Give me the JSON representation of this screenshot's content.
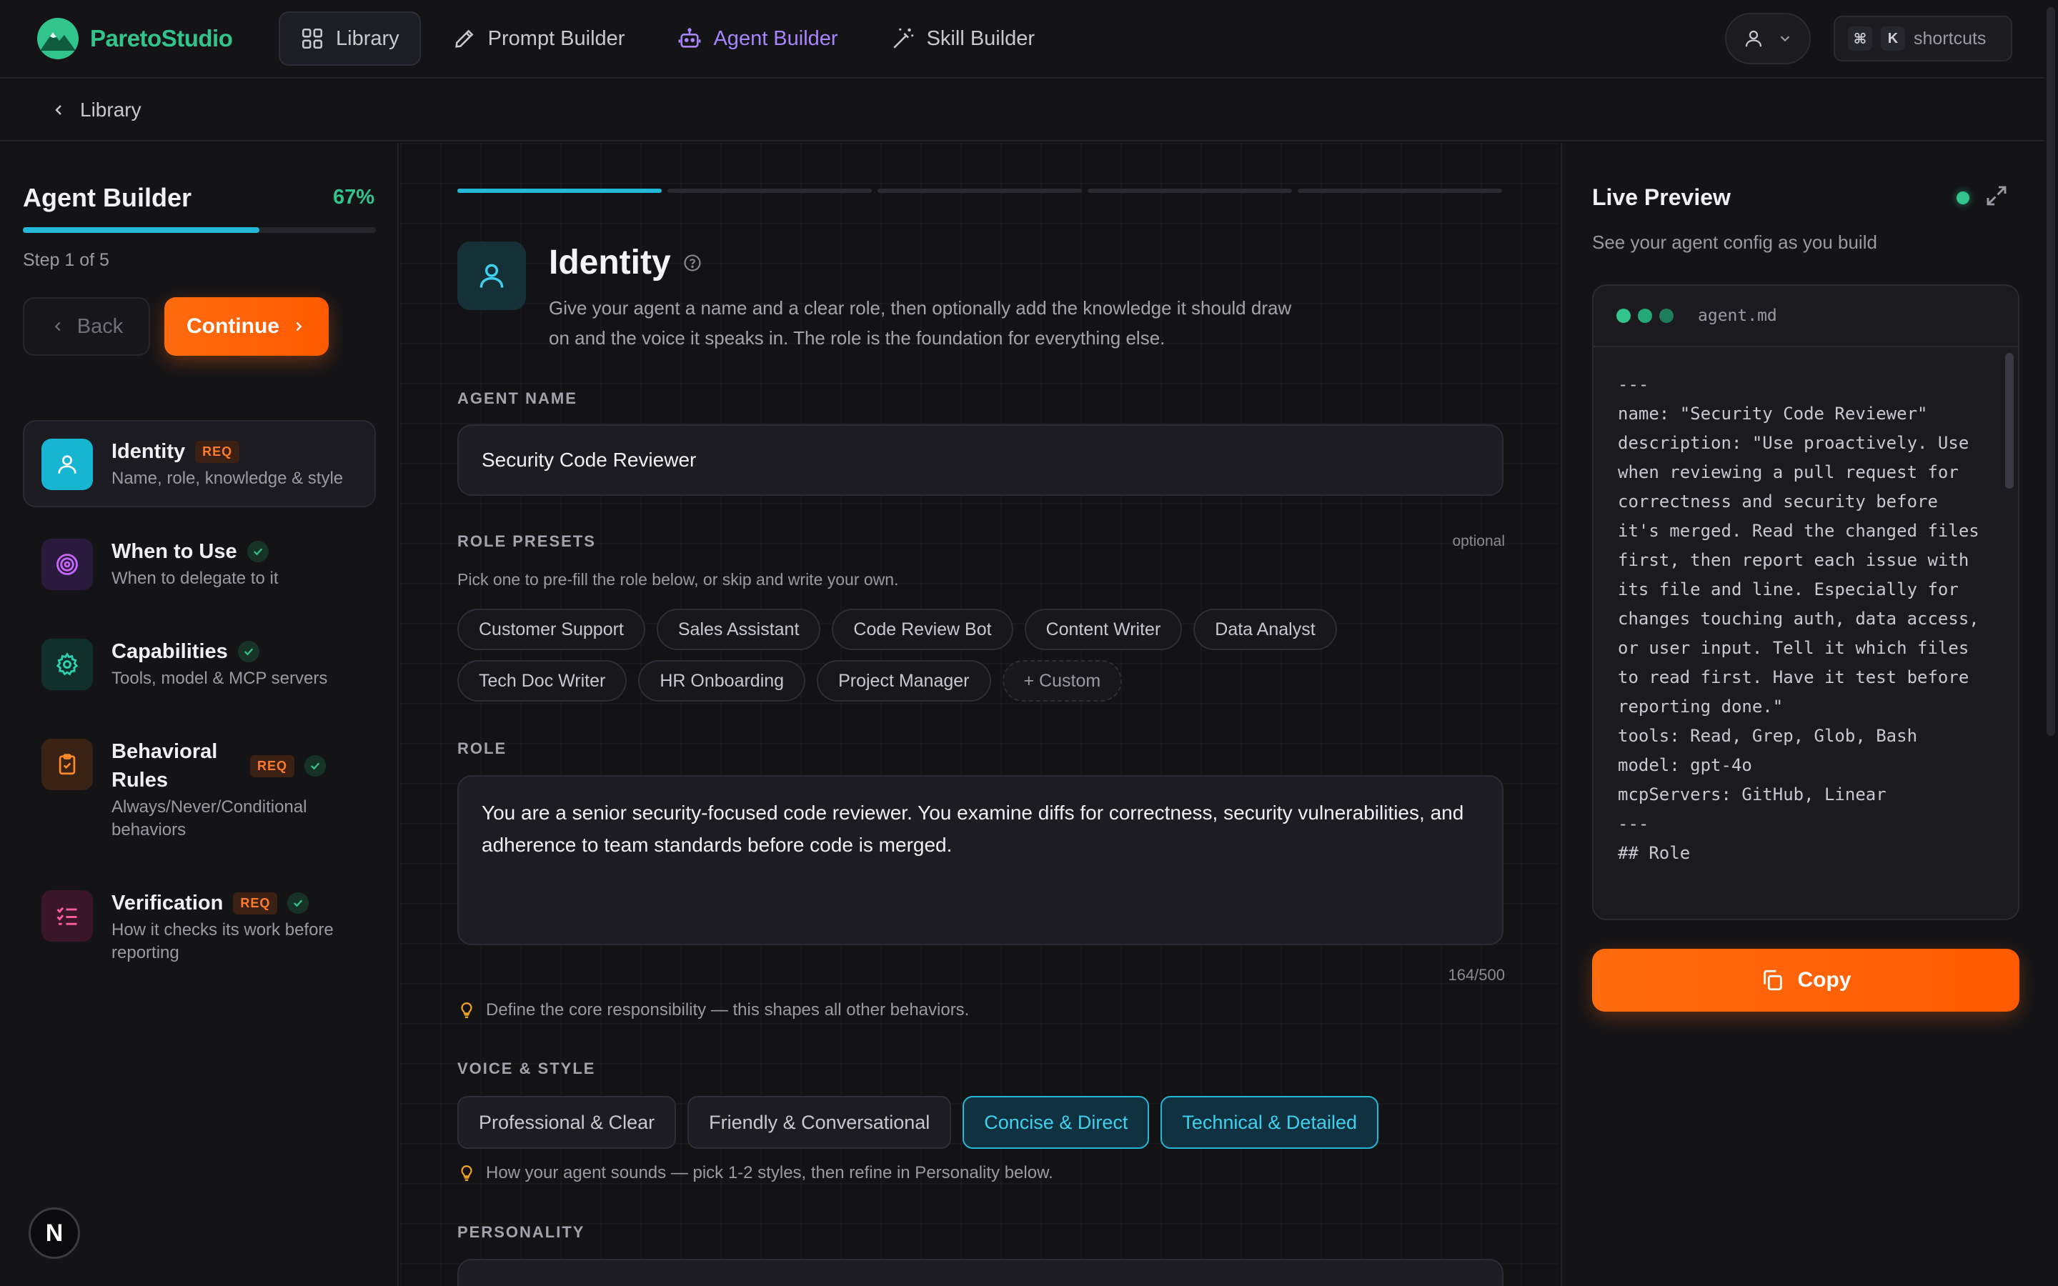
{
  "app": {
    "name": "ParetoStudio"
  },
  "nav": {
    "tabs": [
      {
        "label": "Library"
      },
      {
        "label": "Prompt Builder"
      },
      {
        "label": "Agent Builder"
      },
      {
        "label": "Skill Builder"
      }
    ],
    "active_tab": "Agent Builder",
    "shortcuts": {
      "key1": "⌘",
      "key2": "K",
      "label": "shortcuts"
    }
  },
  "breadcrumb": {
    "label": "Library"
  },
  "sidebar": {
    "title": "Agent Builder",
    "progress_label": "67%",
    "progress_value": 0.67,
    "step_label": "Step 1 of 5",
    "back_label": "Back",
    "continue_label": "Continue",
    "req_label": "REQ",
    "steps": [
      {
        "title": "Identity",
        "subtitle": "Name, role, knowledge & style",
        "required": true,
        "done": false,
        "icon": "user-icon",
        "active": true
      },
      {
        "title": "When to Use",
        "subtitle": "When to delegate to it",
        "required": false,
        "done": true,
        "icon": "target-icon"
      },
      {
        "title": "Capabilities",
        "subtitle": "Tools, model & MCP servers",
        "required": false,
        "done": true,
        "icon": "gear-icon"
      },
      {
        "title": "Behavioral Rules",
        "subtitle": "Always/Never/Conditional behaviors",
        "required": true,
        "done": true,
        "icon": "clipboard-icon"
      },
      {
        "title": "Verification",
        "subtitle": "How it checks its work before reporting",
        "required": true,
        "done": true,
        "icon": "checklist-icon"
      }
    ],
    "badge": "N"
  },
  "main": {
    "progress_segments": 5,
    "progress_active": 1,
    "title": "Identity",
    "description": "Give your agent a name and a clear role, then optionally add the knowledge it should draw on and the voice it speaks in. The role is the foundation for everything else.",
    "agent_name": {
      "label": "AGENT NAME",
      "value": "Security Code Reviewer"
    },
    "role_presets": {
      "label": "ROLE PRESETS",
      "optional": "optional",
      "hint": "Pick one to pre-fill the role below, or skip and write your own.",
      "items": [
        "Customer Support",
        "Sales Assistant",
        "Code Review Bot",
        "Content Writer",
        "Data Analyst",
        "Tech Doc Writer",
        "HR Onboarding",
        "Project Manager",
        "+ Custom"
      ]
    },
    "role": {
      "label": "ROLE",
      "value": "You are a senior security-focused code reviewer. You examine diffs for correctness, security vulnerabilities, and adherence to team standards before code is merged.",
      "counter": "164/500",
      "tip": "Define the core responsibility — this shapes all other behaviors."
    },
    "voice_style": {
      "label": "VOICE & STYLE",
      "options": [
        {
          "label": "Professional & Clear",
          "selected": false
        },
        {
          "label": "Friendly & Conversational",
          "selected": false
        },
        {
          "label": "Concise & Direct",
          "selected": true
        },
        {
          "label": "Technical & Detailed",
          "selected": true
        }
      ],
      "tip": "How your agent sounds — pick 1-2 styles, then refine in Personality below."
    },
    "personality": {
      "label": "PERSONALITY"
    }
  },
  "preview": {
    "title": "Live Preview",
    "subtitle": "See your agent config as you build",
    "filename": "agent.md",
    "lines": [
      "---",
      "name: \"Security Code Reviewer\"",
      "description: \"Use proactively. Use",
      "when reviewing a pull request for",
      "correctness and security before",
      "it's merged. Read the changed files",
      "first, then report each issue with",
      "its file and line. Especially for",
      "changes touching auth, data access,",
      "or user input. Tell it which files",
      "to read first. Have it test before",
      "reporting done.\"",
      "tools: Read, Grep, Glob, Bash",
      "model: gpt-4o",
      "mcpServers: GitHub, Linear",
      "---",
      "",
      "## Role"
    ],
    "copy_label": "Copy"
  },
  "colors": {
    "accent_orange": "#ff6b0f",
    "accent_cyan": "#22b8d6",
    "accent_purple": "#a885ff",
    "success_green": "#31c48d"
  }
}
